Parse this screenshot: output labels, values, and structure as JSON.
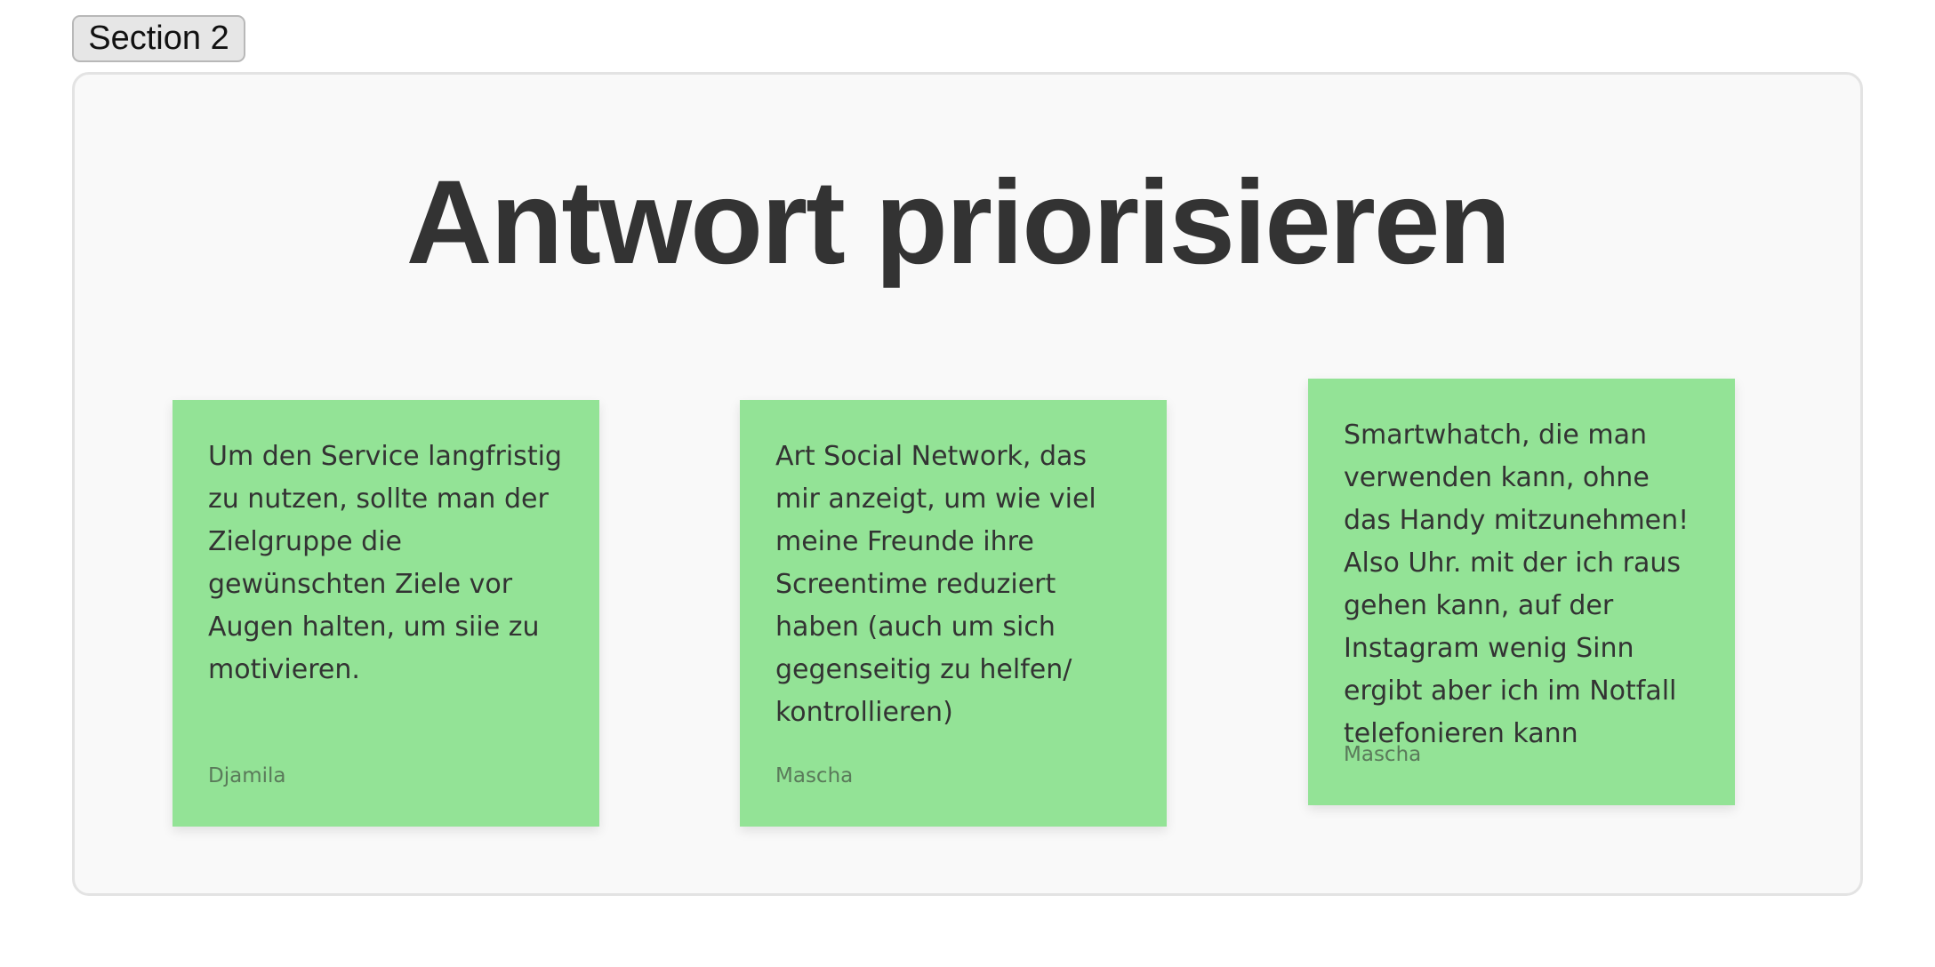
{
  "section": {
    "tab_label": "Section 2"
  },
  "board": {
    "title": "Antwort priorisieren",
    "notes": [
      {
        "text": "Um den Service langfristig\nzu nutzen, sollte man der\nZielgruppe die\ngewünschten Ziele vor\nAugen halten, um siie zu\nmotivieren.",
        "author": "Djamila"
      },
      {
        "text": "Art Social Network, das\nmir anzeigt, um wie viel\nmeine Freunde ihre\nScreentime reduziert\nhaben (auch um sich\ngegenseitig zu helfen/\nkontrollieren)",
        "author": "Mascha"
      },
      {
        "text": "Smartwhatch, die man\nverwenden kann, ohne\ndas Handy mitzunehmen!\nAlso Uhr. mit der ich raus\ngehen kann, auf der\nInstagram wenig Sinn\nergibt aber ich im Notfall\ntelefonieren kann",
        "author": "Mascha"
      }
    ]
  },
  "colors": {
    "note_background": "#93e396",
    "title_text": "#333333",
    "frame_background": "#f9f9f9"
  }
}
